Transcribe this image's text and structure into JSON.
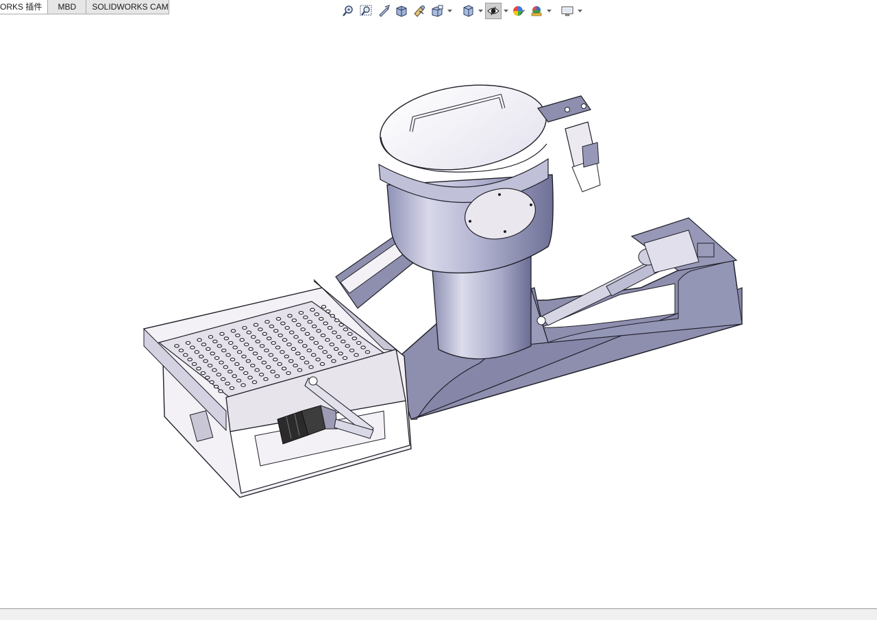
{
  "tabs": [
    {
      "label": "ORKS 插件"
    },
    {
      "label": "MBD"
    },
    {
      "label": "SOLIDWORKS CAM"
    }
  ],
  "toolbar": {
    "icons": [
      "zoom-to-fit-icon",
      "zoom-to-area-icon",
      "previous-view-icon",
      "section-view-icon",
      "dynamic-annotation-views-icon",
      "view-orientation-icon",
      "display-style-icon",
      "hide-show-items-icon",
      "edit-appearance-icon",
      "apply-scene-icon",
      "view-settings-icon"
    ],
    "active": "hide-show-items-icon"
  },
  "colors": {
    "part_gray": "#8e8fae",
    "part_light": "#e8e4ec",
    "tray_white": "#f3f1f5",
    "outline": "#1e1e28",
    "motor_dark": "#2b2b2b"
  }
}
